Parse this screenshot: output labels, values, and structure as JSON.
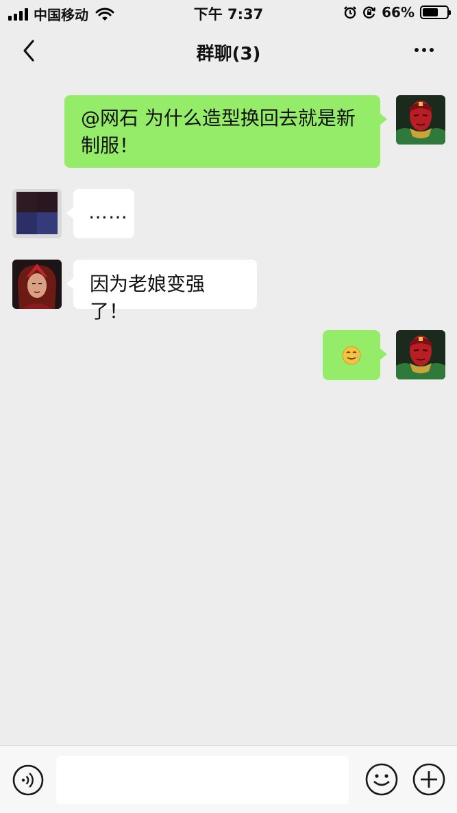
{
  "status_bar": {
    "carrier": "中国移动",
    "time": "下午 7:37",
    "battery_percent": "66%",
    "battery_level": 0.66
  },
  "nav": {
    "title": "群聊(3)"
  },
  "messages": [
    {
      "side": "right",
      "avatar": "vision-avatar",
      "text": "@网石 为什么造型换回去就是新制服！"
    },
    {
      "side": "left",
      "avatar": "pixelated-avatar",
      "text": "……"
    },
    {
      "side": "left",
      "avatar": "scarlet-witch-avatar",
      "text": "因为老娘变强了！"
    },
    {
      "side": "right",
      "avatar": "vision-avatar",
      "text": "",
      "emoji": "sweat-smile-emoji"
    }
  ],
  "input": {
    "value": "",
    "icons": [
      "voice-icon",
      "emoji-icon",
      "plus-icon"
    ]
  },
  "colors": {
    "background": "#ededed",
    "sent_bubble": "#95ec69",
    "received_bubble": "#ffffff"
  }
}
